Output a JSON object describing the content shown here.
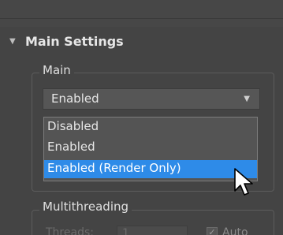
{
  "rollout": {
    "title": "Main Settings",
    "expanded_icon": "triangle-down-icon"
  },
  "main_group": {
    "title": "Main",
    "dropdown": {
      "value": "Enabled",
      "caret_icon": "chevron-down-icon",
      "options": [
        "Disabled",
        "Enabled",
        "Enabled (Render Only)"
      ],
      "highlighted": "Enabled (Render Only)"
    }
  },
  "multithreading_group": {
    "title": "Multithreading",
    "threads_label": "Threads:",
    "threads_value": "1",
    "auto_label": "Auto",
    "auto_checked": true
  },
  "colors": {
    "panel_bg": "#444444",
    "selection": "#2e8be8",
    "text": "#e6e6e6"
  },
  "cursor_icon": "mouse-pointer-icon"
}
